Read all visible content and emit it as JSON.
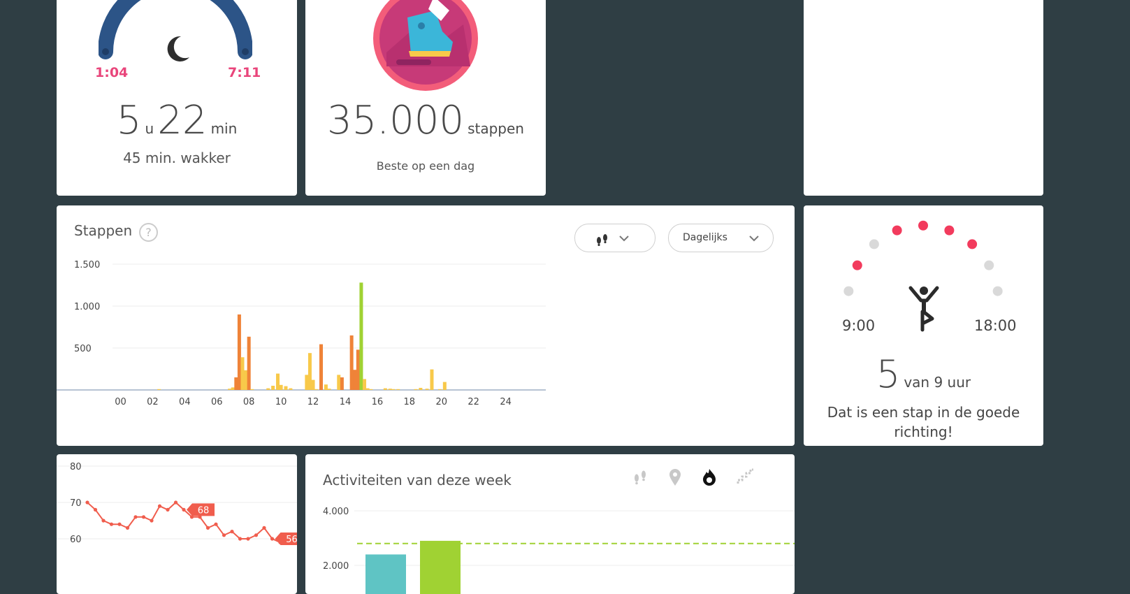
{
  "sleep": {
    "start": "1:04",
    "end": "7:11",
    "hours": "5",
    "hours_unit": "u",
    "minutes": "22",
    "minutes_unit": "min",
    "awake": "45 min. wakker"
  },
  "badge": {
    "value": "35.000",
    "unit": "stappen",
    "caption": "Beste op een dag"
  },
  "steps_chart": {
    "title": "Stappen",
    "help_icon": "?",
    "metric_dropdown_icon": "footsteps-icon",
    "period_dropdown": "Dagelijks",
    "accent": "#f08a3c"
  },
  "chart_data": [
    {
      "type": "bar",
      "title": "Stappen",
      "yticks": [
        "1.500",
        "1.000",
        "500"
      ],
      "ytick_values": [
        1500,
        1000,
        500
      ],
      "xticks": [
        "00",
        "02",
        "04",
        "06",
        "08",
        "10",
        "12",
        "14",
        "16",
        "18",
        "20",
        "22",
        "24"
      ],
      "ylim": [
        0,
        1500
      ],
      "xlim": [
        -0.5,
        26.5
      ],
      "series": [
        {
          "x": [
            2.4,
            6.8,
            7.0,
            7.2,
            7.4,
            7.6,
            7.8,
            8.0,
            8.2,
            9.2,
            9.5,
            9.8,
            10.0,
            10.3,
            10.6,
            11.6,
            11.8,
            12.0,
            12.2,
            12.5,
            12.8,
            13.0,
            13.6,
            13.8,
            14.4,
            14.6,
            14.8,
            15.0,
            15.2,
            15.4,
            15.6,
            16.5,
            16.8,
            17.0,
            17.3,
            18.4,
            18.7,
            19.1,
            19.4,
            19.9,
            20.2
          ],
          "values": [
            10,
            15,
            30,
            150,
            900,
            390,
            235,
            635,
            10,
            20,
            50,
            195,
            60,
            45,
            20,
            180,
            440,
            120,
            10,
            545,
            65,
            15,
            180,
            150,
            650,
            240,
            480,
            1280,
            130,
            20,
            10,
            20,
            15,
            10,
            10,
            10,
            25,
            15,
            245,
            10,
            95
          ],
          "colors": [
            "#f8c94a",
            "#f8c94a",
            "#f8c94a",
            "#ef8338",
            "#ef8338",
            "#f8c94a",
            "#f8c94a",
            "#ef8338",
            "#f8c94a",
            "#f8c94a",
            "#f8c94a",
            "#f8c94a",
            "#f8c94a",
            "#f8c94a",
            "#f8c94a",
            "#f8c94a",
            "#f8c94a",
            "#f8c94a",
            "#f8c94a",
            "#ef8338",
            "#f8c94a",
            "#f8c94a",
            "#f8c94a",
            "#ef8338",
            "#ef8338",
            "#ef8338",
            "#ef8338",
            "#a0d233",
            "#f8c94a",
            "#f8c94a",
            "#f8c94a",
            "#f8c94a",
            "#f8c94a",
            "#f8c94a",
            "#f8c94a",
            "#f8c94a",
            "#f8c94a",
            "#f8c94a",
            "#f8c94a",
            "#f8c94a",
            "#f8c94a"
          ]
        }
      ]
    },
    {
      "type": "line",
      "yticks": [
        "80",
        "70",
        "60"
      ],
      "ytick_values": [
        80,
        70,
        60
      ],
      "ylim": [
        56,
        82
      ],
      "x": [
        0,
        1,
        2,
        3,
        4,
        5,
        6,
        7,
        8,
        9,
        10,
        11,
        12,
        13,
        14,
        15,
        16,
        17,
        18,
        19,
        20,
        21,
        22,
        23,
        24
      ],
      "values": [
        70,
        68,
        65,
        64,
        64,
        63,
        66,
        66,
        65,
        69,
        68,
        70,
        68,
        66,
        66,
        63,
        64,
        61,
        62,
        60,
        60,
        61,
        63,
        60,
        59
      ],
      "callouts": [
        {
          "label": "68",
          "index": 12
        },
        {
          "label": "56",
          "index": 23
        }
      ],
      "color": "#f05d4d"
    },
    {
      "type": "bar",
      "title": "Activiteiten van deze week",
      "yticks": [
        "4.000",
        "2.000"
      ],
      "ytick_values": [
        4000,
        2000
      ],
      "ylim": [
        0,
        4000
      ],
      "values": [
        2400,
        2900
      ],
      "colors": [
        "#5fc4c4",
        "#a0d233"
      ],
      "goal": 2800,
      "goal_color": "#a0d233"
    }
  ],
  "hourly": {
    "start": "9:00",
    "end": "18:00",
    "count": "5",
    "count_suffix": "van 9 uur",
    "message": "Dat is een stap in de goede richting!",
    "dots": [
      false,
      true,
      false,
      true,
      true,
      true,
      true,
      false,
      false
    ],
    "active_color": "#f23b5d",
    "inactive_color": "#d9d9d9"
  },
  "weekly": {
    "title": "Activiteiten van deze week",
    "icons": [
      "footsteps-icon",
      "location-icon",
      "flame-icon",
      "stairs-icon"
    ]
  }
}
